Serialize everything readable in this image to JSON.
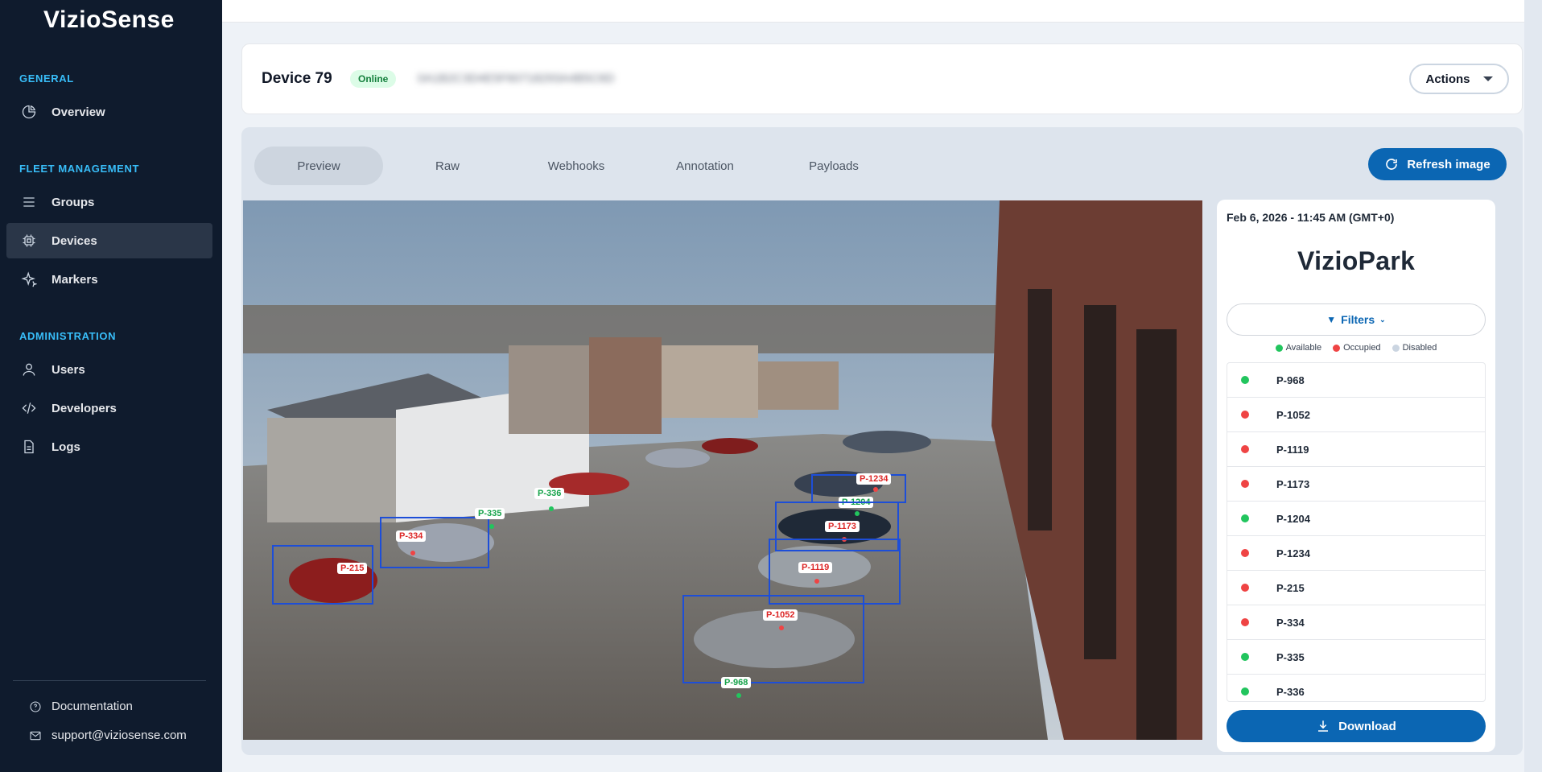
{
  "brand": {
    "name": "VizioSense"
  },
  "sidebar": {
    "sections": [
      {
        "title": "GENERAL"
      },
      {
        "title": "FLEET MANAGEMENT"
      },
      {
        "title": "ADMINISTRATION"
      }
    ],
    "items": [
      {
        "label": "Overview",
        "icon": "pie-chart-icon"
      },
      {
        "label": "Groups",
        "icon": "list-icon"
      },
      {
        "label": "Devices",
        "icon": "chip-icon",
        "active": true
      },
      {
        "label": "Markers",
        "icon": "sparkle-icon"
      },
      {
        "label": "Users",
        "icon": "users-icon"
      },
      {
        "label": "Developers",
        "icon": "code-icon"
      },
      {
        "label": "Logs",
        "icon": "file-icon"
      }
    ],
    "footer": {
      "documentation": "Documentation",
      "support_email": "support@viziosense.com"
    }
  },
  "device": {
    "title": "Device 79",
    "status": "Online",
    "id_blurred": "0A1B2C3D4E5F60718293A4B5C6D",
    "actions_label": "Actions"
  },
  "tabs": [
    "Preview",
    "Raw",
    "Webhooks",
    "Annotation",
    "Payloads"
  ],
  "active_tab": "Preview",
  "refresh_label": "Refresh image",
  "detections": [
    {
      "label": "P-215",
      "status": "occupied"
    },
    {
      "label": "P-334",
      "status": "occupied"
    },
    {
      "label": "P-335",
      "status": "available"
    },
    {
      "label": "P-336",
      "status": "available"
    },
    {
      "label": "P-1234",
      "status": "occupied"
    },
    {
      "label": "P-1204",
      "status": "available"
    },
    {
      "label": "P-1173",
      "status": "occupied"
    },
    {
      "label": "P-1119",
      "status": "occupied"
    },
    {
      "label": "P-1052",
      "status": "occupied"
    },
    {
      "label": "P-968",
      "status": "available"
    }
  ],
  "right_panel": {
    "timestamp": "Feb 6, 2026 - 11:45 AM (GMT+0)",
    "product_logo": "VizioPark",
    "filters_label": "Filters",
    "legend": {
      "available": "Available",
      "occupied": "Occupied",
      "disabled": "Disabled"
    },
    "spots": [
      {
        "label": "P-968",
        "status": "available"
      },
      {
        "label": "P-1052",
        "status": "occupied"
      },
      {
        "label": "P-1119",
        "status": "occupied"
      },
      {
        "label": "P-1173",
        "status": "occupied"
      },
      {
        "label": "P-1204",
        "status": "available"
      },
      {
        "label": "P-1234",
        "status": "occupied"
      },
      {
        "label": "P-215",
        "status": "occupied"
      },
      {
        "label": "P-334",
        "status": "occupied"
      },
      {
        "label": "P-335",
        "status": "available"
      },
      {
        "label": "P-336",
        "status": "available"
      }
    ],
    "download_label": "Download"
  },
  "colors": {
    "available": "#22c55e",
    "occupied": "#ef4444",
    "disabled": "#cbd5e1",
    "accent": "#0b66b3",
    "sidebar_bg": "#0f1b2d"
  }
}
